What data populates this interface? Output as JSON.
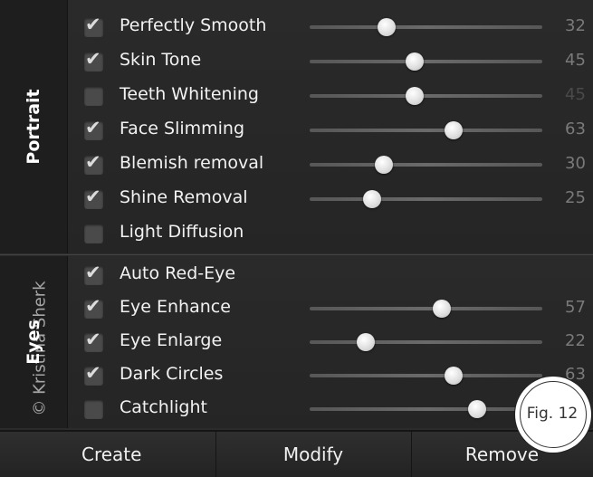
{
  "sections": {
    "portrait_label": "Portrait",
    "eyes_label": "Eyes"
  },
  "portrait": [
    {
      "label": "Perfectly Smooth",
      "checked": true,
      "value": "32",
      "level": 0.33
    },
    {
      "label": "Skin Tone",
      "checked": true,
      "value": "45",
      "level": 0.45
    },
    {
      "label": "Teeth Whitening",
      "checked": false,
      "value": "45",
      "level": 0.45
    },
    {
      "label": "Face Slimming",
      "checked": true,
      "value": "63",
      "level": 0.62
    },
    {
      "label": "Blemish removal",
      "checked": true,
      "value": "30",
      "level": 0.32
    },
    {
      "label": "Shine Removal",
      "checked": true,
      "value": "25",
      "level": 0.27
    },
    {
      "label": "Light Diffusion",
      "checked": false,
      "value": "",
      "level": null
    }
  ],
  "eyes": [
    {
      "label": "Auto Red-Eye",
      "checked": true,
      "value": "",
      "level": null
    },
    {
      "label": "Eye Enhance",
      "checked": true,
      "value": "57",
      "level": 0.57
    },
    {
      "label": "Eye Enlarge",
      "checked": true,
      "value": "22",
      "level": 0.24
    },
    {
      "label": "Dark Circles",
      "checked": true,
      "value": "63",
      "level": 0.62
    },
    {
      "label": "Catchlight",
      "checked": false,
      "value": "",
      "level": 0.72
    }
  ],
  "buttons": {
    "create": "Create",
    "modify": "Modify",
    "remove": "Remove"
  },
  "overlay": {
    "copyright": "© Kristina Sherk",
    "figure": "Fig. 12"
  },
  "icons": {
    "checkmark": "checkmark-icon"
  }
}
